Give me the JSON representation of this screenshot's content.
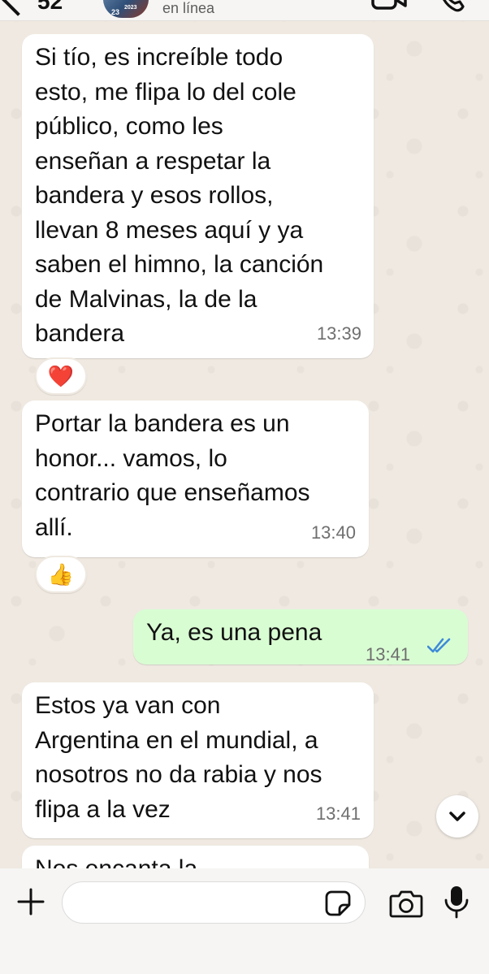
{
  "header": {
    "back_count": "52",
    "avatar_text": "23",
    "avatar_text2": "2023",
    "status": "en línea"
  },
  "messages": [
    {
      "direction": "in",
      "text": "Si tío, es increíble todo\nesto, me flipa lo del cole\npúblico, como les\nenseñan a respetar la\nbandera y esos rollos,\nllevan 8 meses aquí y ya\nsaben el himno, la canción\nde Malvinas, la de la\nbandera",
      "time": "13:39",
      "reaction": "❤️"
    },
    {
      "direction": "in",
      "text": "Portar la bandera es un\nhonor... vamos, lo\ncontrario que enseñamos\nallí.",
      "time": "13:40",
      "reaction": "👍"
    },
    {
      "direction": "out",
      "text": "Ya, es una pena",
      "time": "13:41",
      "status": "read"
    },
    {
      "direction": "in",
      "text": "Estos ya van con\nArgentina en el mundial, a\nnosotros no da rabia y nos\nflipa a la vez",
      "time": "13:41"
    },
    {
      "direction": "in",
      "text": "Nos encanta la",
      "time": ""
    }
  ],
  "input": {
    "value": "",
    "placeholder": ""
  },
  "icons": {
    "back": "chevron-left-icon",
    "video": "video-camera-icon",
    "call": "phone-icon",
    "scroll": "chevron-down-icon",
    "plus": "plus-icon",
    "sticker": "sticker-icon",
    "camera": "camera-icon",
    "mic": "microphone-icon",
    "read": "double-check-icon"
  },
  "colors": {
    "incoming_bubble": "#ffffff",
    "outgoing_bubble": "#d9fdd3",
    "read_ticks": "#3e8bd9",
    "background": "#efe9e1"
  }
}
